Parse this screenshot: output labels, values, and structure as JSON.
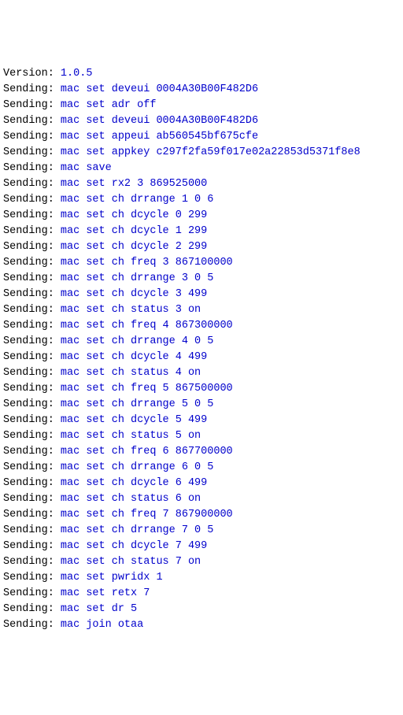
{
  "version": {
    "label": "Version: ",
    "value": "1.0.5"
  },
  "lines": [
    {
      "prefix": "Sending: ",
      "cmd": "mac set deveui 0004A30B00F482D6"
    },
    {
      "prefix": "Sending: ",
      "cmd": "mac set adr off"
    },
    {
      "prefix": "Sending: ",
      "cmd": "mac set deveui 0004A30B00F482D6"
    },
    {
      "prefix": "Sending: ",
      "cmd": "mac set appeui ab560545bf675cfe"
    },
    {
      "prefix": "Sending: ",
      "cmd": "mac set appkey c297f2fa59f017e02a22853d5371f8e8"
    },
    {
      "prefix": "Sending: ",
      "cmd": "mac save"
    },
    {
      "prefix": "Sending: ",
      "cmd": "mac set rx2 3 869525000"
    },
    {
      "prefix": "Sending: ",
      "cmd": "mac set ch drrange 1 0 6"
    },
    {
      "prefix": "Sending: ",
      "cmd": "mac set ch dcycle 0 299"
    },
    {
      "prefix": "Sending: ",
      "cmd": "mac set ch dcycle 1 299"
    },
    {
      "prefix": "Sending: ",
      "cmd": "mac set ch dcycle 2 299"
    },
    {
      "prefix": "Sending: ",
      "cmd": "mac set ch freq 3 867100000"
    },
    {
      "prefix": "Sending: ",
      "cmd": "mac set ch drrange 3 0 5"
    },
    {
      "prefix": "Sending: ",
      "cmd": "mac set ch dcycle 3 499"
    },
    {
      "prefix": "Sending: ",
      "cmd": "mac set ch status 3 on"
    },
    {
      "prefix": "Sending: ",
      "cmd": "mac set ch freq 4 867300000"
    },
    {
      "prefix": "Sending: ",
      "cmd": "mac set ch drrange 4 0 5"
    },
    {
      "prefix": "Sending: ",
      "cmd": "mac set ch dcycle 4 499"
    },
    {
      "prefix": "Sending: ",
      "cmd": "mac set ch status 4 on"
    },
    {
      "prefix": "Sending: ",
      "cmd": "mac set ch freq 5 867500000"
    },
    {
      "prefix": "Sending: ",
      "cmd": "mac set ch drrange 5 0 5"
    },
    {
      "prefix": "Sending: ",
      "cmd": "mac set ch dcycle 5 499"
    },
    {
      "prefix": "Sending: ",
      "cmd": "mac set ch status 5 on"
    },
    {
      "prefix": "Sending: ",
      "cmd": "mac set ch freq 6 867700000"
    },
    {
      "prefix": "Sending: ",
      "cmd": "mac set ch drrange 6 0 5"
    },
    {
      "prefix": "Sending: ",
      "cmd": "mac set ch dcycle 6 499"
    },
    {
      "prefix": "Sending: ",
      "cmd": "mac set ch status 6 on"
    },
    {
      "prefix": "Sending: ",
      "cmd": "mac set ch freq 7 867900000"
    },
    {
      "prefix": "Sending: ",
      "cmd": "mac set ch drrange 7 0 5"
    },
    {
      "prefix": "Sending: ",
      "cmd": "mac set ch dcycle 7 499"
    },
    {
      "prefix": "Sending: ",
      "cmd": "mac set ch status 7 on"
    },
    {
      "prefix": "Sending: ",
      "cmd": "mac set pwridx 1"
    },
    {
      "prefix": "Sending: ",
      "cmd": "mac set retx 7"
    },
    {
      "prefix": "Sending: ",
      "cmd": "mac set dr 5"
    },
    {
      "prefix": "Sending: ",
      "cmd": "mac join otaa"
    }
  ]
}
